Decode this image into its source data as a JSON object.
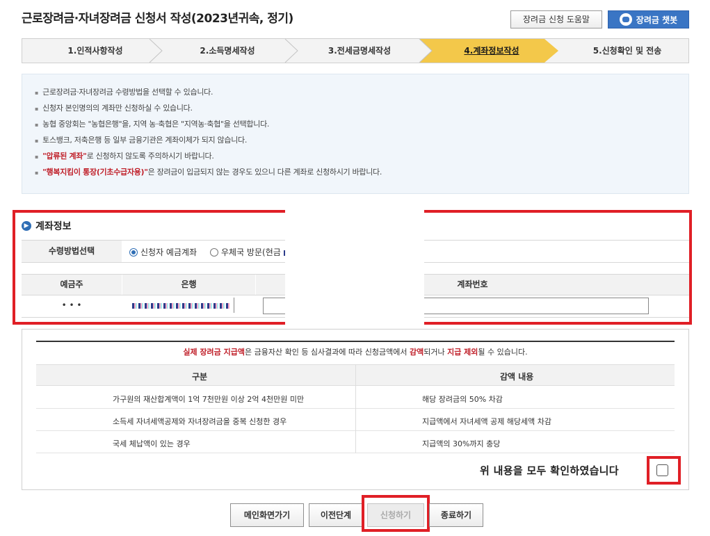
{
  "page": {
    "title": "근로장려금·자녀장려금 신청서 작성(2023년귀속, 정기)",
    "help_button": "장려금 신청 도움말",
    "chatbot_button": "장려금 챗봇"
  },
  "steps": [
    {
      "label": "1.인적사항작성",
      "active": false
    },
    {
      "label": "2.소득명세작성",
      "active": false
    },
    {
      "label": "3.전세금명세작성",
      "active": false
    },
    {
      "label": "4.계좌정보작성",
      "active": true
    },
    {
      "label": "5.신청확인 및 전송",
      "active": false
    }
  ],
  "info": {
    "items": [
      {
        "text": "근로장려금·자녀장려금 수령방법을 선택할 수 있습니다."
      },
      {
        "text": "신청자 본인명의의 계좌만 신청하실 수 있습니다."
      },
      {
        "text": "농협 중앙회는 \"농협은행\"을, 지역 농·축협은 \"지역농·축협\"을 선택합니다."
      },
      {
        "text": "토스뱅크, 저축은행 등 일부 금융기관은 계좌이체가 되지 않습니다."
      },
      {
        "highlight": "\"압류된 계좌\"",
        "rest": "로 신청하지 않도록 주의하시기 바랍니다."
      },
      {
        "highlight": "\"행복지킴이 통장(기초수급자용)\"",
        "rest": "은 장려금이 입금되지 않는 경우도 있으니 다른 계좌로 신청하시기 바랍니다."
      }
    ]
  },
  "account": {
    "section_title": "계좌정보",
    "method_label": "수령방법선택",
    "option1": "신청자 예금계좌",
    "option2": "우체국 방문(현금",
    "col_holder": "예금주",
    "col_bank": "은행",
    "col_number": "계좌번호",
    "holder_value": "• • •"
  },
  "notice": {
    "part1": "실제 장려금 지급액",
    "part2": "은 금융자산 확인 등 심사결과에 따라 신청금액에서 ",
    "part3": "감액",
    "part4": "되거나 ",
    "part5": "지급 제외",
    "part6": "될 수 있습니다.",
    "col1": "구분",
    "col2": "감액 내용",
    "rows": [
      {
        "category": "가구원의 재산합계액이 1억 7천만원 이상 2억 4천만원 미만",
        "reduction": "해당 장려금의 50% 차감"
      },
      {
        "category": "소득세 자녀세액공제와 자녀장려금을 중복 신청한 경우",
        "reduction": "지급액에서 자녀세액 공제 해당세액 차감"
      },
      {
        "category": "국세 체납액이 있는 경우",
        "reduction": "지급액의 30%까지 충당"
      }
    ],
    "confirm_text": "위 내용을 모두 확인하였습니다"
  },
  "buttons": {
    "main": "메인화면가기",
    "prev": "이전단계",
    "apply": "신청하기",
    "exit": "종료하기"
  }
}
